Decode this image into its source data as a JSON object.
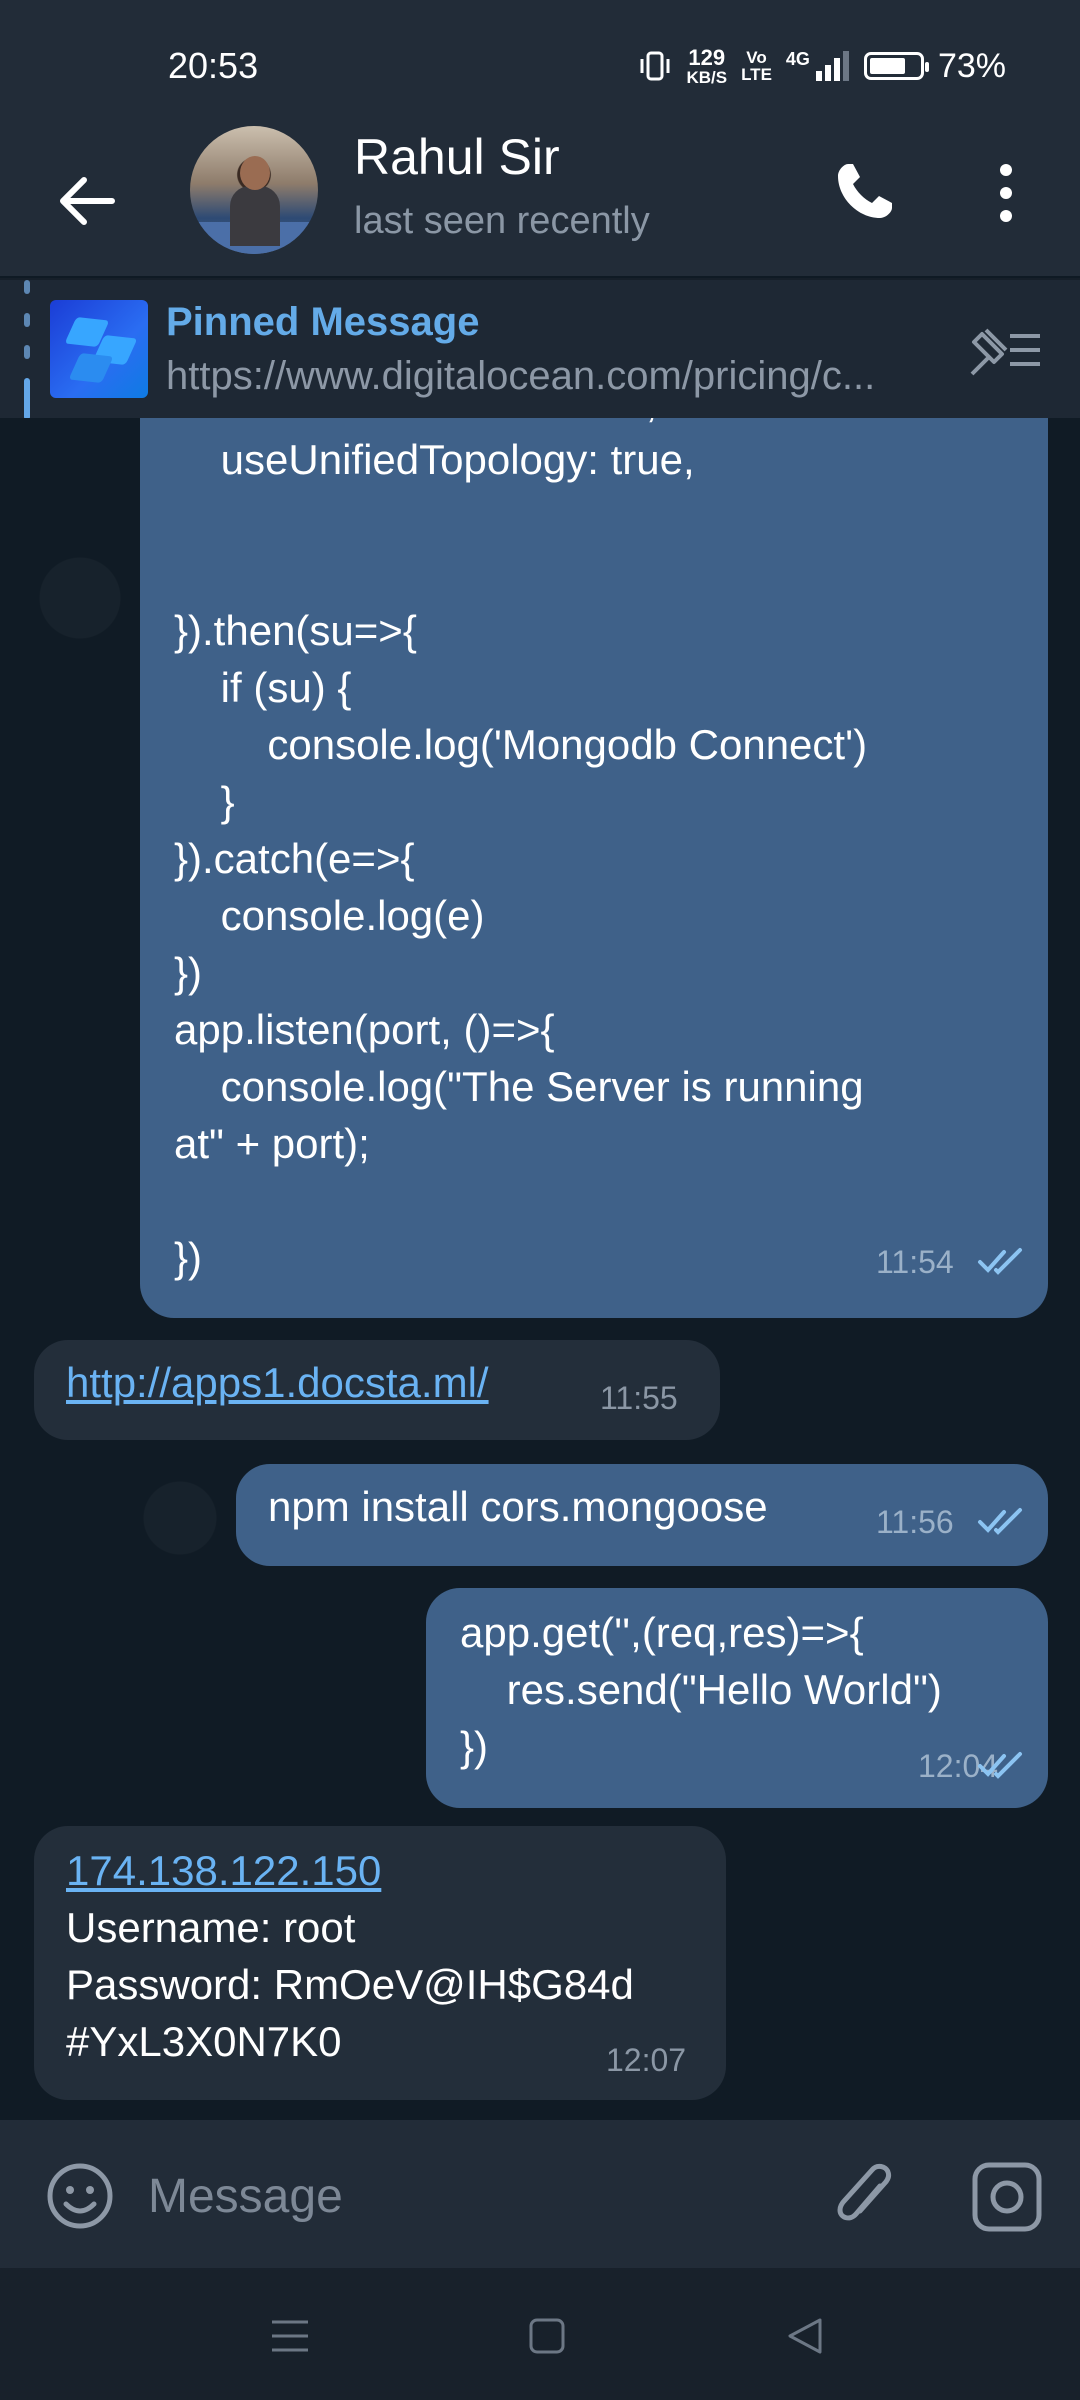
{
  "status_bar": {
    "time": "20:53",
    "net_speed_value": "129",
    "net_speed_unit": "KB/S",
    "volte_top": "Vo",
    "volte_bottom": "LTE",
    "network": "4G",
    "battery_percent": "73%",
    "battery_level": 0.73
  },
  "header": {
    "contact_name": "Rahul Sir",
    "contact_status": "last seen recently"
  },
  "pinned": {
    "title": "Pinned Message",
    "text": "https://www.digitalocean.com/pricing/c..."
  },
  "messages": [
    {
      "direction": "out",
      "text": "    useNewUrlParser: true,\n    useUnifiedTopology: true,\n\n\n}).then(su=>{\n    if (su) {\n        console.log('Mongodb Connect')\n    }\n}).catch(e=>{\n    console.log(e)\n})\napp.listen(port, ()=>{\n    console.log(\"The Server is running\nat\" + port);\n\n})",
      "time": "11:54",
      "read": true
    },
    {
      "direction": "in",
      "link": "http://apps1.docsta.ml/",
      "time": "11:55"
    },
    {
      "direction": "out",
      "text": "npm install cors.mongoose",
      "time": "11:56",
      "read": true
    },
    {
      "direction": "out",
      "text": "app.get('',(req,res)=>{\n    res.send(\"Hello World\")\n})",
      "time": "12:04",
      "read": true
    },
    {
      "direction": "in",
      "link": "174.138.122.150",
      "text": "Username: root\nPassword: RmOeV@IH$G84d\n#YxL3X0N7K0",
      "time": "12:07"
    }
  ],
  "input": {
    "placeholder": "Message"
  },
  "colors": {
    "outgoing_bubble": "#3f6189",
    "incoming_bubble": "#232e3a",
    "link": "#6ab3f3",
    "bars": "#222c38"
  }
}
